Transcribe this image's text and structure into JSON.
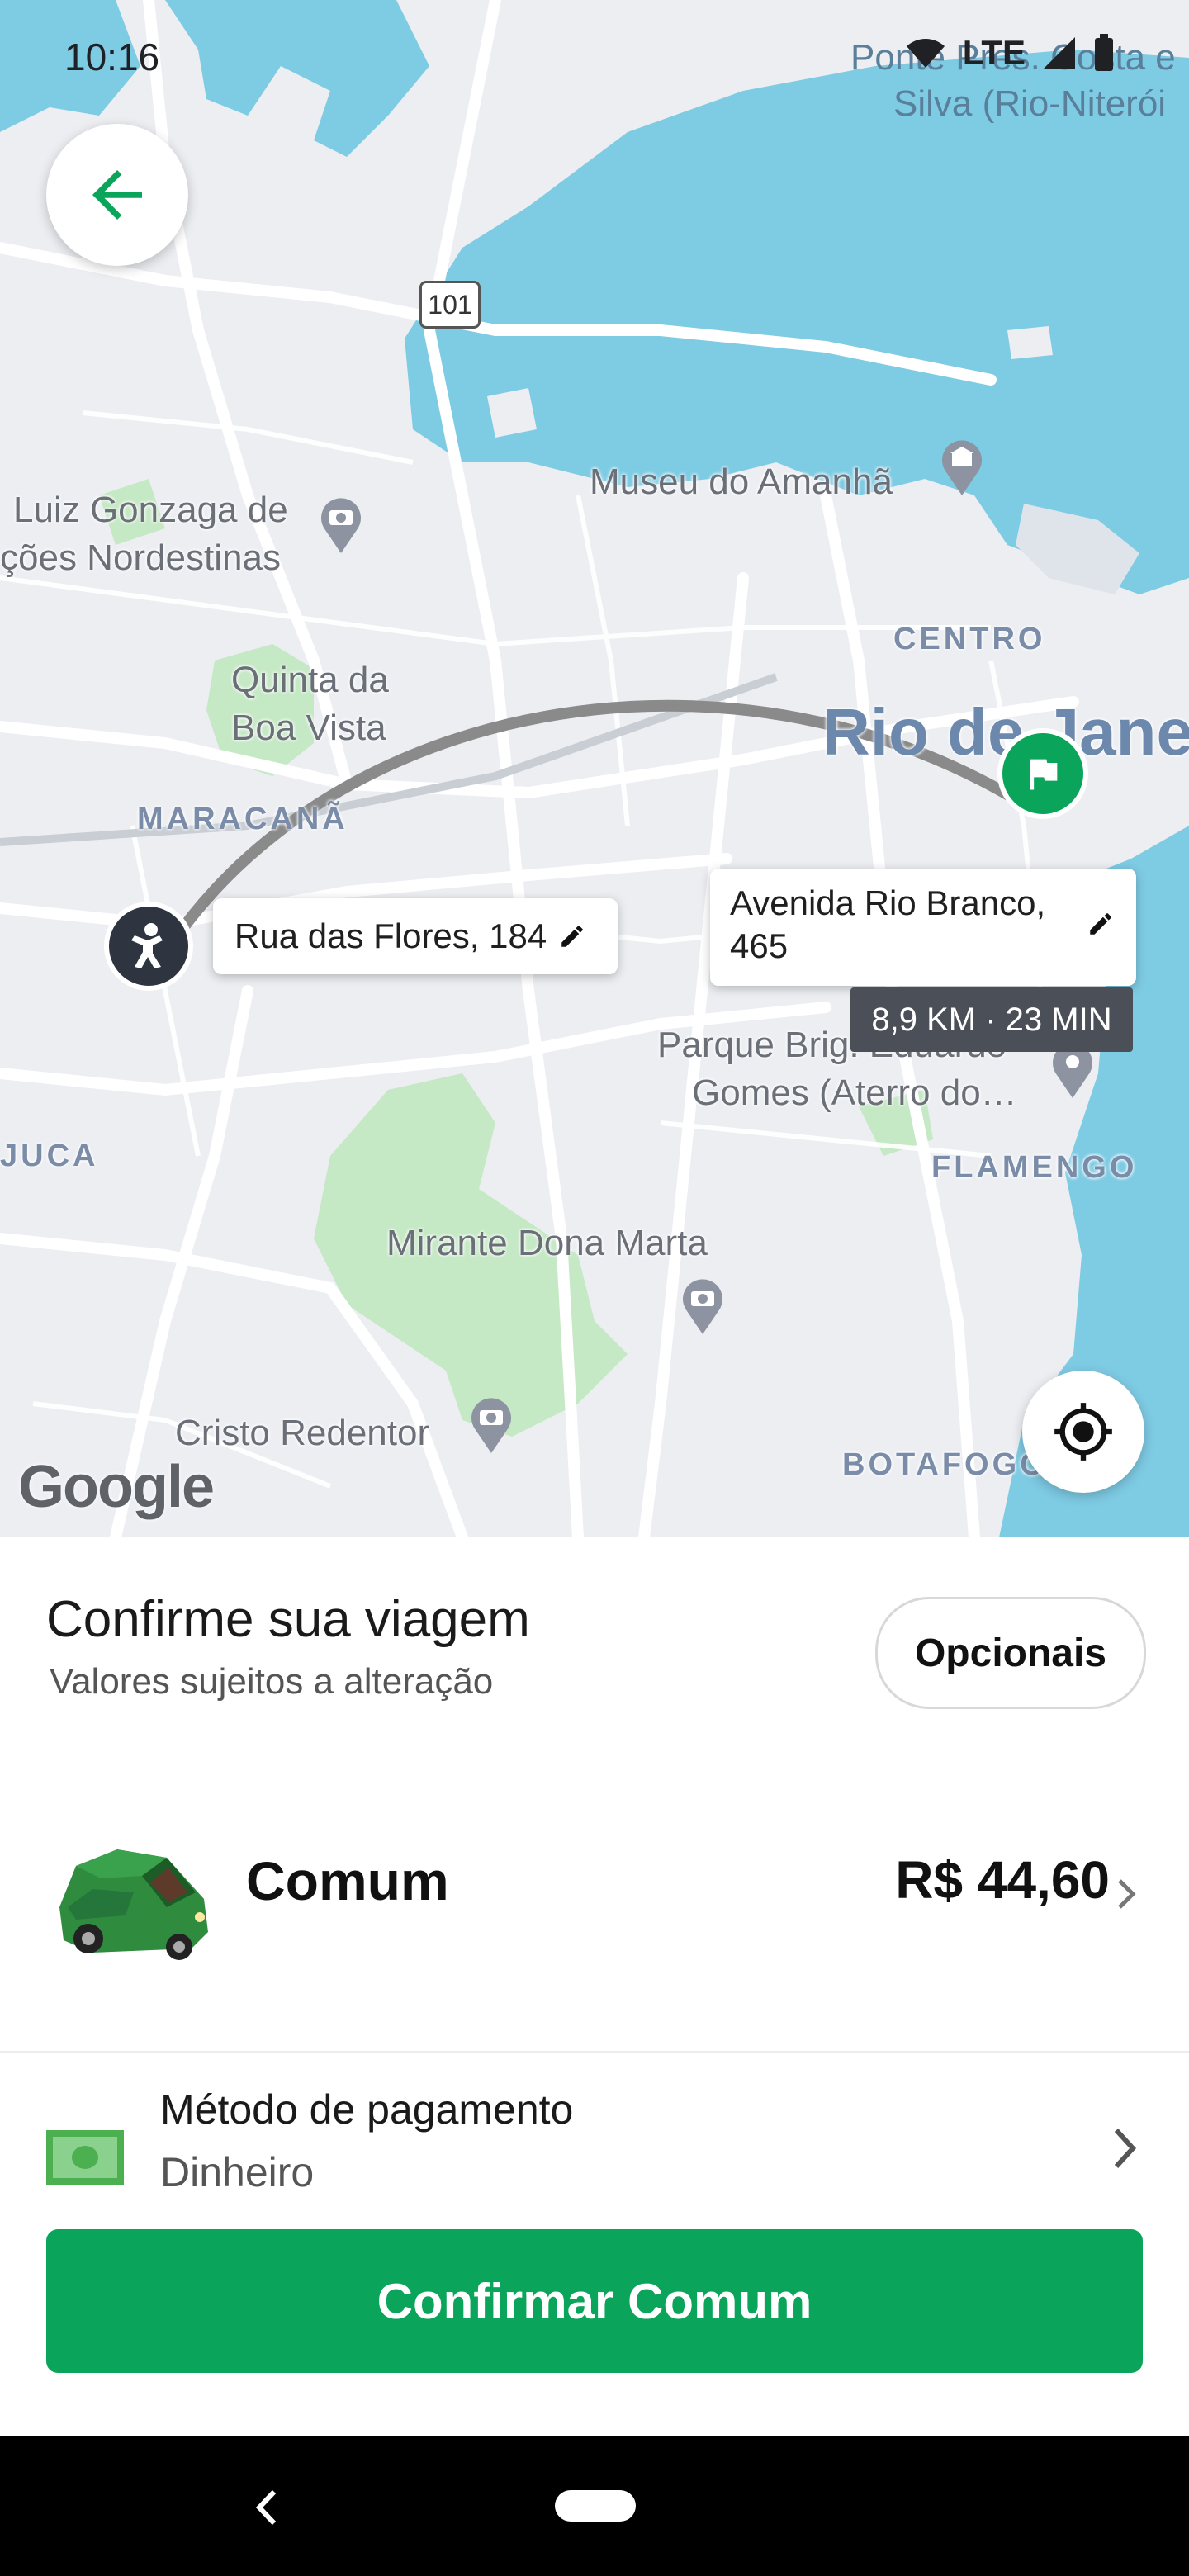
{
  "status_bar": {
    "time": "10:16",
    "network": "LTE"
  },
  "map": {
    "labels": {
      "ponte": "Ponte Pres. Costa e Silva (Rio-Niterói)",
      "ponte_line1": "Ponte Pres. Costa e",
      "ponte_line2": "Silva (Rio-Niterói",
      "highway": "101",
      "museu": "Museu do Amanhã",
      "gonzaga_1": "Luiz Gonzaga de",
      "gonzaga_2": "ções Nordestinas",
      "centro": "CENTRO",
      "rio": "Rio de Janeiro",
      "quinta_1": "Quinta da",
      "quinta_2": "Boa Vista",
      "maracana": "MARACANÃ",
      "juca": "JUCA",
      "parque_1": "Parque Brig. Eduardo",
      "parque_2": "Gomes (Aterro do…",
      "flamengo": "FLAMENGO",
      "mirante": "Mirante Dona Marta",
      "cristo": "Cristo Redentor",
      "botafogo": "BOTAFOGO",
      "google": "Google"
    },
    "origin": {
      "label": "Rua das Flores, 184"
    },
    "destination": {
      "label_line1": "Avenida Rio Branco,",
      "label_line2": "465"
    },
    "eta": "8,9 KM · 23 MIN",
    "colors": {
      "water": "#7ecbe4",
      "park": "#c5e8c5",
      "route": "#8a8a8a",
      "brand": "#0aa45a"
    }
  },
  "sheet": {
    "title": "Confirme sua viagem",
    "subtitle": "Valores sujeitos a alteração",
    "optional_button": "Opcionais",
    "ride": {
      "name": "Comum",
      "price": "R$ 44,60"
    },
    "payment": {
      "label": "Método de pagamento",
      "value": "Dinheiro"
    },
    "confirm_button": "Confirmar Comum"
  },
  "icons": [
    "back-arrow-icon",
    "wifi-icon",
    "signal-icon",
    "battery-icon",
    "edit-icon",
    "flag-icon",
    "passenger-icon",
    "locate-icon",
    "car-icon",
    "cash-icon",
    "chevron-right-icon",
    "nav-back-icon"
  ]
}
